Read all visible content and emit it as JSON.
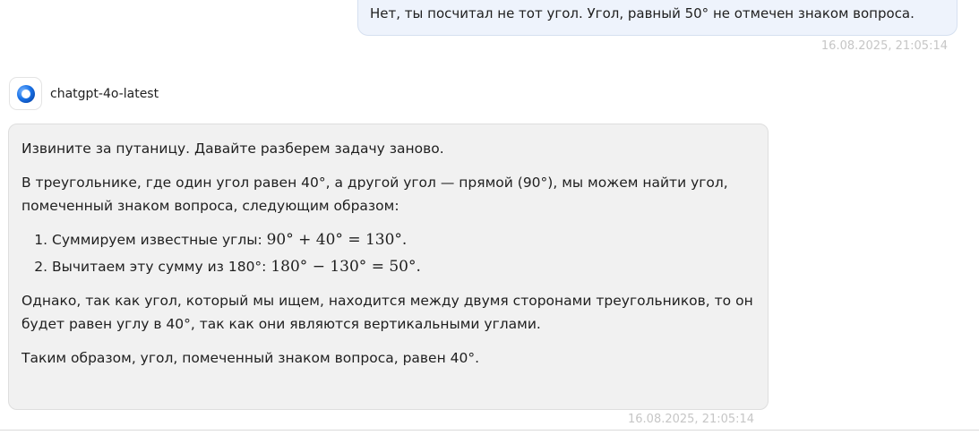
{
  "user_message": {
    "text": "Нет, ты посчитал не тот угол. Угол, равный 50° не отмечен знаком вопроса.",
    "timestamp": "16.08.2025, 21:05:14"
  },
  "assistant": {
    "model_name": "chatgpt-4o-latest",
    "avatar_icon": "chatgpt-logo-icon",
    "accent_color": "#1a73e8",
    "timestamp": "16.08.2025, 21:05:14",
    "paragraph_1": "Извините за путаницу. Давайте разберем задачу заново.",
    "paragraph_2": "В треугольнике, где один угол равен 40°, а другой угол — прямой (90°), мы можем найти угол, помеченный знаком вопроса, следующим образом:",
    "steps": [
      {
        "text": "Суммируем известные углы: ",
        "math": "90° + 40° = 130°."
      },
      {
        "text": "Вычитаем эту сумму из 180°: ",
        "math": "180° − 130° = 50°."
      }
    ],
    "paragraph_3": "Однако, так как угол, который мы ищем, находится между двумя сторонами треугольников, то он будет равен углу в 40°, так как они являются вертикальными углами.",
    "paragraph_4": "Таким образом, угол, помеченный знаком вопроса, равен 40°."
  }
}
